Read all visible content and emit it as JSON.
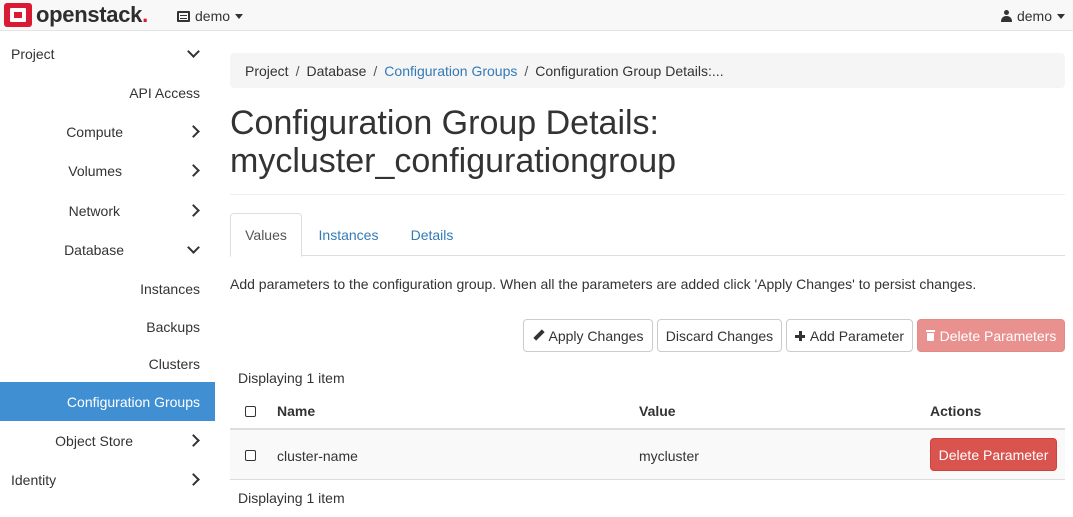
{
  "topbar": {
    "logo_text": "openstack",
    "logo_dot": ".",
    "project": "demo",
    "user": "demo"
  },
  "sidebar": {
    "items": [
      {
        "label": "Project",
        "chevron": "down"
      },
      {
        "label": "API Access",
        "chevron": ""
      },
      {
        "label": "Compute",
        "chevron": "right"
      },
      {
        "label": "Volumes",
        "chevron": "right"
      },
      {
        "label": "Network",
        "chevron": "right"
      },
      {
        "label": "Database",
        "chevron": "down"
      },
      {
        "label": "Instances",
        "chevron": ""
      },
      {
        "label": "Backups",
        "chevron": ""
      },
      {
        "label": "Clusters",
        "chevron": ""
      },
      {
        "label": "Configuration Groups",
        "chevron": "",
        "active": true
      },
      {
        "label": "Object Store",
        "chevron": "right"
      },
      {
        "label": "Identity",
        "chevron": "right"
      }
    ]
  },
  "breadcrumb": {
    "items": [
      "Project",
      "Database",
      "Configuration Groups",
      "Configuration Group Details:..."
    ],
    "separator": "/"
  },
  "page": {
    "title_line1": "Configuration Group Details:",
    "title_line2": "mycluster_configurationgroup"
  },
  "tabs": [
    "Values",
    "Instances",
    "Details"
  ],
  "help_text": "Add parameters to the configuration group. When all the parameters are added click 'Apply Changes' to persist changes.",
  "actions": {
    "apply": "Apply Changes",
    "discard": "Discard Changes",
    "add": "Add Parameter",
    "delete_all": "Delete Parameters"
  },
  "table": {
    "count_top": "Displaying 1 item",
    "count_bottom": "Displaying 1 item",
    "headers": [
      "Name",
      "Value",
      "Actions"
    ],
    "rows": [
      {
        "name": "cluster-name",
        "value": "mycluster",
        "action": "Delete Parameter"
      }
    ]
  },
  "colors": {
    "accent": "#3f8fd2",
    "link": "#337ab7",
    "danger": "#d9534f",
    "brand": "#da1a32"
  }
}
